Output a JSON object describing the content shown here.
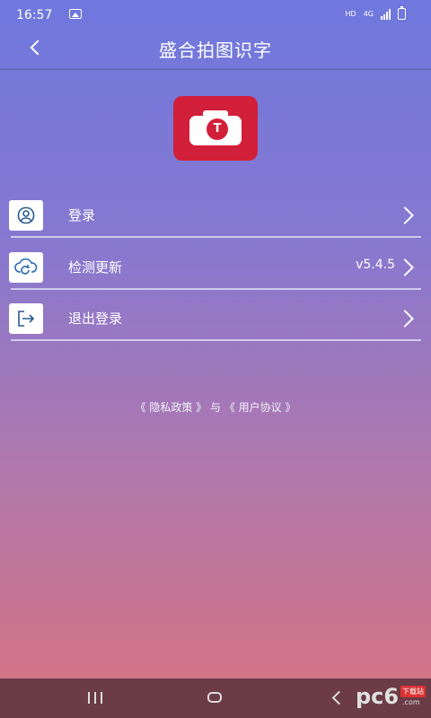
{
  "status_bar": {
    "time": "16:57",
    "network_hd": "HD",
    "network_4g": "4G"
  },
  "header": {
    "title": "盛合拍图识字",
    "back_icon": "chevron-left-icon"
  },
  "logo": {
    "letter": "T",
    "color": "#d21f3a"
  },
  "menu": {
    "items": [
      {
        "label": "登录",
        "icon": "user-icon",
        "value": ""
      },
      {
        "label": "检测更新",
        "icon": "cloud-refresh-icon",
        "value": "v5.4.5"
      },
      {
        "label": "退出登录",
        "icon": "logout-icon",
        "value": ""
      }
    ]
  },
  "policy": {
    "privacy": "《 隐私政策 》",
    "connector": "与",
    "agreement": "《 用户协议 》"
  },
  "watermark": {
    "brand": "pc6",
    "tag": "下载站",
    "domain": ".com"
  }
}
